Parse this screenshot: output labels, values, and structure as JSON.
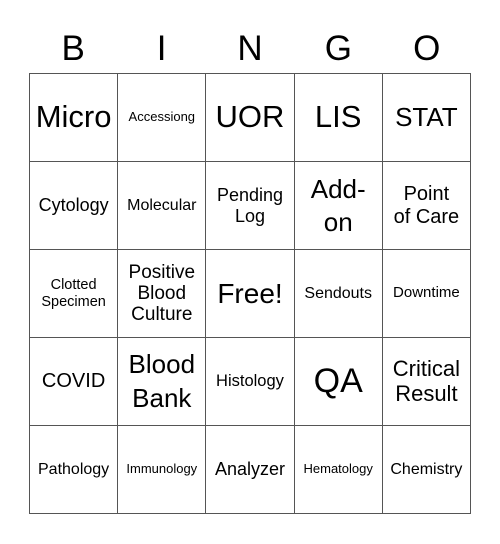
{
  "header": {
    "letters": [
      "B",
      "I",
      "N",
      "G",
      "O"
    ]
  },
  "cells": [
    [
      "Micro",
      "Accessiong",
      "UOR",
      "LIS",
      "STAT"
    ],
    [
      "Cytology",
      "Molecular",
      "Pending\nLog",
      "Add-\non",
      "Point\nof Care"
    ],
    [
      "Clotted\nSpecimen",
      "Positive\nBlood\nCulture",
      "Free!",
      "Sendouts",
      "Downtime"
    ],
    [
      "COVID",
      "Blood\nBank",
      "Histology",
      "QA",
      "Critical\nResult"
    ],
    [
      "Pathology",
      "Immunology",
      "Analyzer",
      "Hematology",
      "Chemistry"
    ]
  ]
}
